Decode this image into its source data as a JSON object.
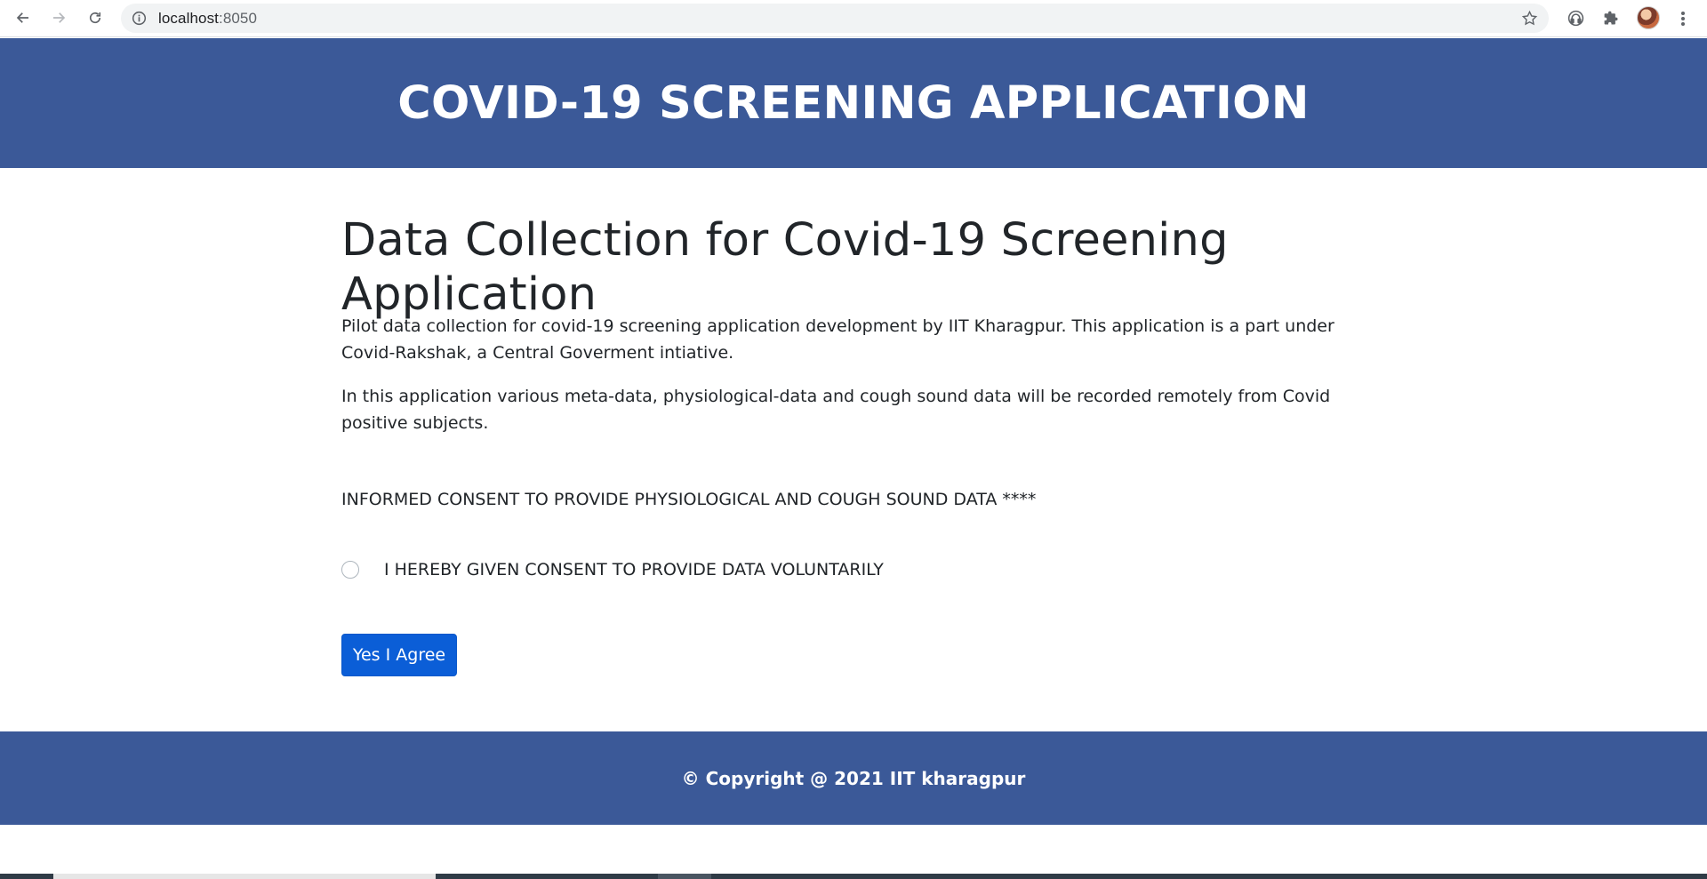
{
  "browser": {
    "url_host": "localhost",
    "url_port": ":8050"
  },
  "header": {
    "title": "COVID-19 SCREENING APPLICATION"
  },
  "main": {
    "title": "Data Collection for Covid-19 Screening Application",
    "paragraph1": "Pilot data collection for covid-19 screening application development by IIT Kharagpur. This application is a part under Covid-Rakshak, a Central Goverment intiative.",
    "paragraph2": "In this application various meta-data, physiological-data and cough sound data will be recorded remotely from Covid positive subjects.",
    "consent_heading": "INFORMED CONSENT TO PROVIDE PHYSIOLOGICAL AND COUGH SOUND DATA ****",
    "consent_option": "I HEREBY GIVEN CONSENT TO PROVIDE DATA VOLUNTARILY",
    "consent_checked": false,
    "agree_button": "Yes I Agree"
  },
  "footer": {
    "copyright": "© Copyright @ 2021  IIT kharagpur"
  },
  "colors": {
    "brand": "#3b5998",
    "button": "#0b5ed7"
  },
  "icons": {
    "back": "back-arrow-icon",
    "forward": "forward-arrow-icon",
    "reload": "reload-icon",
    "info": "info-icon",
    "bookmark": "star-icon",
    "extension1": "headset-icon",
    "extensions": "puzzle-icon",
    "profile": "avatar",
    "menu": "kebab-menu-icon"
  }
}
